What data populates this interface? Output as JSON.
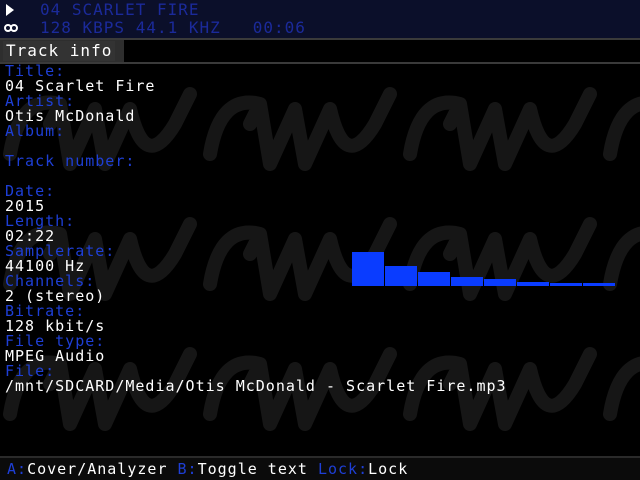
{
  "status": {
    "play_icon": "play-icon",
    "stereo_icon": "stereo-icon",
    "track_title": "04 SCARLET FIRE",
    "stream_info": "128 KBPS 44.1 KHZ",
    "elapsed": "00:06",
    "accent_color": "#1b2a9a"
  },
  "header": {
    "title": "Track info"
  },
  "track": {
    "title_label": "Title:",
    "title_value": "04 Scarlet Fire",
    "artist_label": "Artist:",
    "artist_value": "Otis McDonald",
    "album_label": "Album:",
    "album_value": "",
    "track_number_label": "Track number:",
    "track_number_value": "",
    "date_label": "Date:",
    "date_value": "2015",
    "length_label": "Length:",
    "length_value": "02:22",
    "samplerate_label": "Samplerate:",
    "samplerate_value": "44100 Hz",
    "channels_label": "Channels:",
    "channels_value": "2 (stereo)",
    "bitrate_label": "Bitrate:",
    "bitrate_value": "128 kbit/s",
    "filetype_label": "File type:",
    "filetype_value": "MPEG Audio",
    "file_label": "File:",
    "file_value": "/mnt/SDCARD/Media/Otis McDonald - Scarlet Fire.mp3",
    "label_color": "#1e3fd6"
  },
  "analyzer": {
    "bar_color": "#0a3cff",
    "levels": [
      1.0,
      0.6,
      0.4,
      0.25,
      0.2,
      0.13,
      0.1,
      0.08
    ]
  },
  "footer": {
    "a_key": "A:",
    "a_action": "Cover/Analyzer",
    "b_key": "B:",
    "b_action": "Toggle text",
    "lock_key": "Lock:",
    "lock_action": "Lock"
  }
}
